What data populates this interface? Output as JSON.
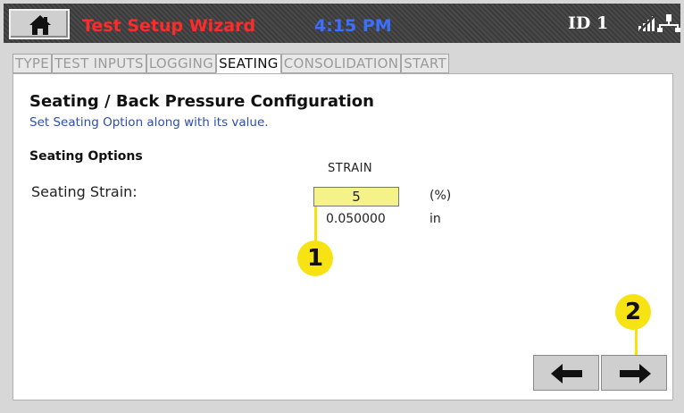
{
  "header": {
    "title": "Test Setup Wizard",
    "time": "4:15 PM",
    "id_label": "ID 1"
  },
  "tabs": [
    {
      "label": "TYPE",
      "active": false
    },
    {
      "label": "TEST INPUTS",
      "active": false
    },
    {
      "label": "LOGGING",
      "active": false
    },
    {
      "label": "SEATING",
      "active": true
    },
    {
      "label": "CONSOLIDATION",
      "active": false
    },
    {
      "label": "START",
      "active": false
    }
  ],
  "page": {
    "heading": "Seating / Back Pressure Configuration",
    "subtitle": "Set Seating Option along with its value.",
    "section_title": "Seating Options",
    "column_header": "STRAIN",
    "field_label": "Seating Strain:",
    "field_value": "5",
    "field_unit": "(%)",
    "computed_value": "0.050000",
    "computed_unit": "in"
  },
  "callouts": {
    "one": "1",
    "two": "2"
  },
  "icons": {
    "home": "home-icon",
    "signal": "signal-off-icon",
    "network": "network-icon",
    "back": "arrow-left-icon",
    "next": "arrow-right-icon"
  },
  "colors": {
    "title": "#ff2a2a",
    "time": "#3a6fff",
    "subtitle": "#2c4fb0",
    "input_bg": "#f6f28a",
    "callout": "#f7e313"
  }
}
